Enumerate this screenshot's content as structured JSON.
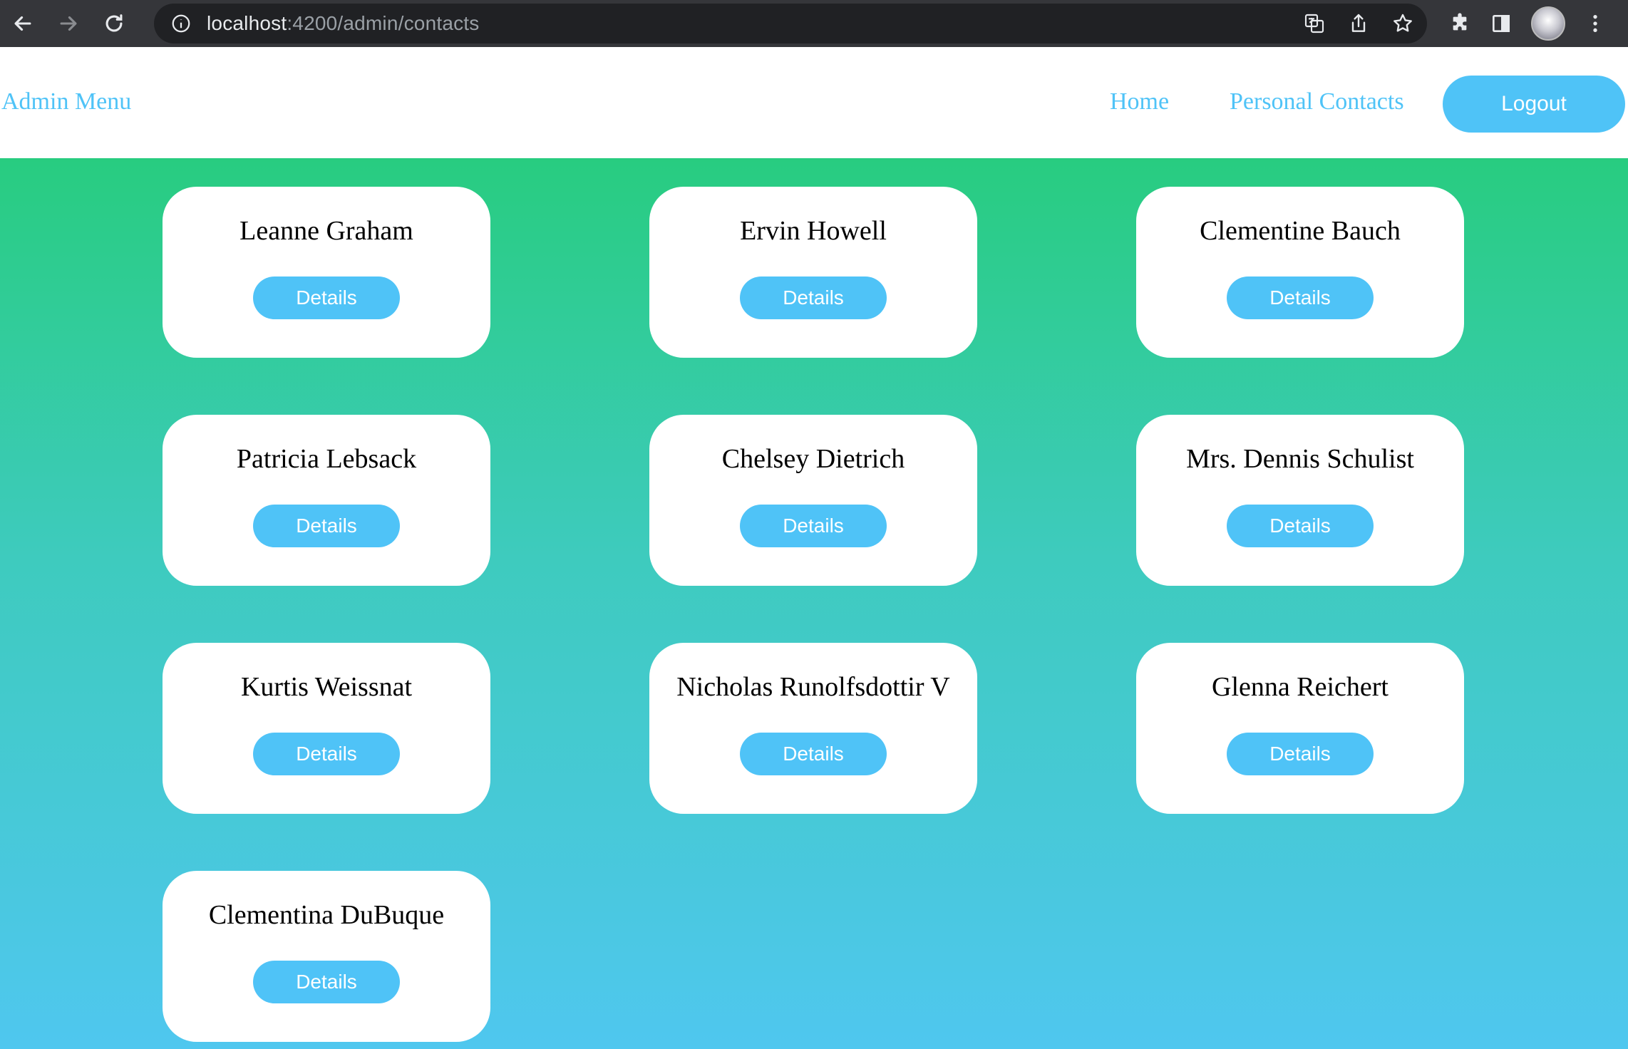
{
  "browser": {
    "url_host": "localhost",
    "url_path": ":4200/admin/contacts"
  },
  "header": {
    "brand": "Admin Menu",
    "nav": [
      "Home",
      "Personal Contacts"
    ],
    "logout_label": "Logout"
  },
  "contacts": [
    {
      "name": "Leanne Graham",
      "button": "Details"
    },
    {
      "name": "Ervin Howell",
      "button": "Details"
    },
    {
      "name": "Clementine Bauch",
      "button": "Details"
    },
    {
      "name": "Patricia Lebsack",
      "button": "Details"
    },
    {
      "name": "Chelsey Dietrich",
      "button": "Details"
    },
    {
      "name": "Mrs. Dennis Schulist",
      "button": "Details"
    },
    {
      "name": "Kurtis Weissnat",
      "button": "Details"
    },
    {
      "name": "Nicholas Runolfsdottir V",
      "button": "Details"
    },
    {
      "name": "Glenna Reichert",
      "button": "Details"
    },
    {
      "name": "Clementina DuBuque",
      "button": "Details"
    }
  ],
  "colors": {
    "accent": "#4fc3f7",
    "gradient_top": "#28cc80",
    "gradient_bottom": "#4fc7ef"
  }
}
